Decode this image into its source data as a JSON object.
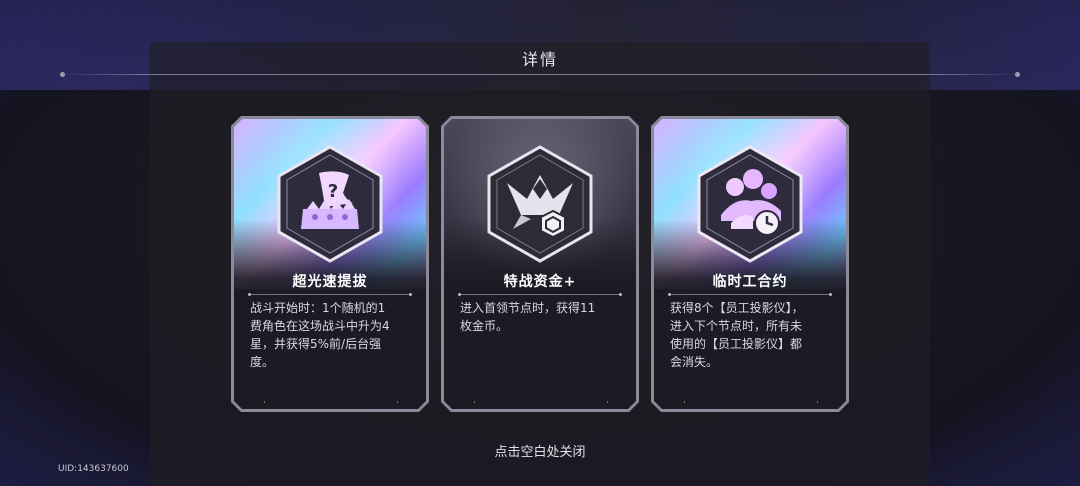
{
  "header": {
    "title": "详情"
  },
  "cards": [
    {
      "name": "超光速提拔",
      "icon": "crown-banner-question-icon",
      "style": "holo",
      "desc_lines": [
        "战斗开始时：1个随机的1",
        "费角色在这场战斗中升为4",
        "星，并获得5%前/后台强",
        "度。"
      ]
    },
    {
      "name": "特战资金+",
      "icon": "emblem-coin-icon",
      "style": "dark",
      "desc_lines": [
        "进入首领节点时，获得11",
        "枚金币。"
      ]
    },
    {
      "name": "临时工合约",
      "icon": "staff-clock-icon",
      "style": "holo",
      "desc_lines": [
        "获得8个【员工投影仪】，",
        "进入下个节点时，所有未",
        "使用的【员工投影仪】都",
        "会消失。"
      ]
    }
  ],
  "footer": {
    "close_hint": "点击空白处关闭",
    "uid": "UID:143637600"
  }
}
